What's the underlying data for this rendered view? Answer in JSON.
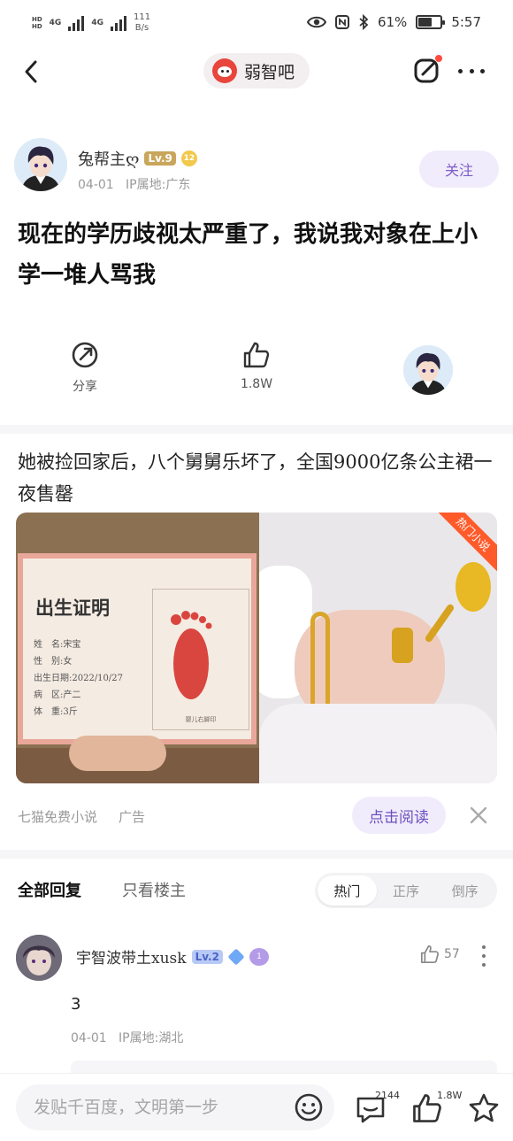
{
  "status_bar": {
    "net_speed": "111",
    "net_unit": "B/s",
    "sim1_label": "HD",
    "sim2_label": "HD",
    "network1": "4G",
    "network2": "4G",
    "battery_percent": "61%",
    "battery_fraction": 0.61,
    "time": "5:57"
  },
  "nav": {
    "forum_name": "弱智吧"
  },
  "author": {
    "name": "兔帮主ღ",
    "level": "Lv.9",
    "badge_number": "12",
    "date": "04-01",
    "ip_location": "IP属地:广东",
    "follow_label": "关注"
  },
  "post": {
    "title": "现在的学历歧视太严重了，我说我对象在上小学一堆人骂我"
  },
  "actions": {
    "share_label": "分享",
    "like_count": "1.8W"
  },
  "ad": {
    "title": "她被捡回家后，八个舅舅乐坏了，全国9000亿条公主裙一夜售罄",
    "tag": "热门小说",
    "cert_title": "出生证明",
    "cert_fields": [
      "姓　名:宋宝",
      "性　别:女",
      "出生日期:2022/10/27",
      "病　区:产二",
      "体　重:3斤"
    ],
    "cert_foot_caption": "婴儿右脚印",
    "source": "七猫免费小说",
    "label": "广告",
    "read_button": "点击阅读"
  },
  "replies": {
    "tab_all": "全部回复",
    "tab_op_only": "只看楼主",
    "sort_options": [
      "热门",
      "正序",
      "倒序"
    ],
    "active_sort": 0
  },
  "comment": {
    "author": "宇智波带土xusk",
    "level": "Lv.2",
    "crown_number": "1",
    "like_count": "57",
    "text": "3",
    "date": "04-01",
    "ip_location": "IP属地:湖北"
  },
  "bottom_bar": {
    "input_placeholder": "发贴千百度，文明第一步",
    "comment_count": "2144",
    "like_count": "1.8W"
  },
  "colors": {
    "accent_purple": "#7b5cc9",
    "pill_bg": "#f1ecfb",
    "ad_tag": "#ff5a2a",
    "notification_dot": "#ff4a3d"
  }
}
